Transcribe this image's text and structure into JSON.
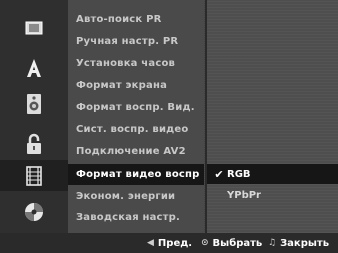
{
  "sidebar": {
    "icons": [
      {
        "name": "disc-tray-icon"
      },
      {
        "name": "language-a-icon"
      },
      {
        "name": "speaker-audio-icon"
      },
      {
        "name": "padlock-icon"
      },
      {
        "name": "film-icon"
      },
      {
        "name": "disc-icon"
      }
    ],
    "selected_index": 4
  },
  "menu": {
    "items": [
      {
        "label": "Авто-поиск PR"
      },
      {
        "label": "Ручная настр. PR"
      },
      {
        "label": "Установка часов"
      },
      {
        "label": "Формат экрана"
      },
      {
        "label": "Формат воспр. Вид."
      },
      {
        "label": "Сист. воспр. видео"
      },
      {
        "label": "Подключение AV2"
      },
      {
        "label": "Формат видео воспр"
      },
      {
        "label": "Эконом. энергии"
      },
      {
        "label": "Заводская настр."
      }
    ],
    "active_index": 7
  },
  "submenu": {
    "options": [
      {
        "label": "RGB",
        "checked": true
      },
      {
        "label": "YPbPr",
        "checked": false
      }
    ],
    "check_glyph": "✔"
  },
  "footer": {
    "prev_label": "Пред.",
    "select_label": "Выбрать",
    "close_label": "Закрыть",
    "prev_glyph": "◀",
    "select_glyph": "⊙",
    "close_glyph": "♫"
  },
  "colors": {
    "active_row": "#161616",
    "text": "#c8c8c8",
    "text_active": "#ffffff"
  }
}
